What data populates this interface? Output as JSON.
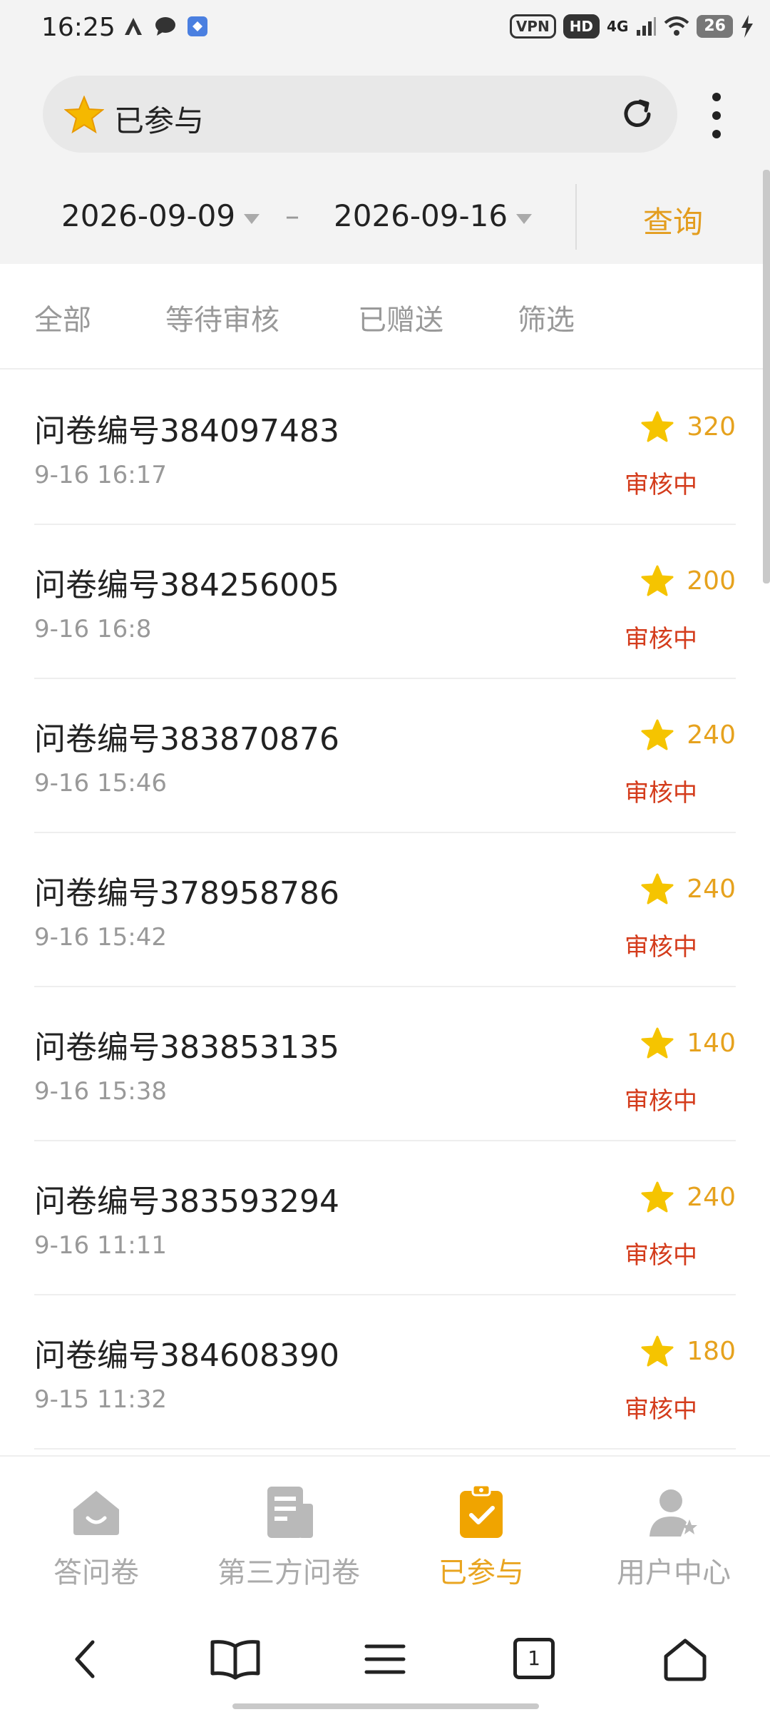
{
  "status_bar": {
    "time": "16:25",
    "vpn": "VPN",
    "hd": "HD",
    "network": "4G",
    "battery": "26"
  },
  "header": {
    "title": "已参与",
    "icons": [
      "star-icon",
      "refresh-icon",
      "more-vertical-icon"
    ]
  },
  "date_filter": {
    "start": "2026-09-09",
    "separator": "–",
    "end": "2026-09-16",
    "query_label": "查询"
  },
  "tabs": [
    {
      "label": "全部"
    },
    {
      "label": "等待审核"
    },
    {
      "label": "已赠送"
    },
    {
      "label": "筛选"
    }
  ],
  "records": [
    {
      "title": "问卷编号384097483",
      "time": "9-16 16:17",
      "points": "320",
      "status": "审核中"
    },
    {
      "title": "问卷编号384256005",
      "time": "9-16 16:8",
      "points": "200",
      "status": "审核中"
    },
    {
      "title": "问卷编号383870876",
      "time": "9-16 15:46",
      "points": "240",
      "status": "审核中"
    },
    {
      "title": "问卷编号378958786",
      "time": "9-16 15:42",
      "points": "240",
      "status": "审核中"
    },
    {
      "title": "问卷编号383853135",
      "time": "9-16 15:38",
      "points": "140",
      "status": "审核中"
    },
    {
      "title": "问卷编号383593294",
      "time": "9-16 11:11",
      "points": "240",
      "status": "审核中"
    },
    {
      "title": "问卷编号384608390",
      "time": "9-15 11:32",
      "points": "180",
      "status": "审核中"
    }
  ],
  "bottom_nav": [
    {
      "label": "答问卷",
      "icon": "home-icon",
      "active": false
    },
    {
      "label": "第三方问卷",
      "icon": "document-icon",
      "active": false
    },
    {
      "label": "已参与",
      "icon": "clipboard-check-icon",
      "active": true
    },
    {
      "label": "用户中心",
      "icon": "user-icon",
      "active": false
    }
  ],
  "browser_bar": {
    "tab_count": "1",
    "icons": [
      "back-icon",
      "bookmarks-icon",
      "menu-icon",
      "tabs-icon",
      "home-icon"
    ]
  },
  "colors": {
    "accent": "#e9a521",
    "status_red": "#d43c1c",
    "star_yellow": "#f5c400"
  }
}
